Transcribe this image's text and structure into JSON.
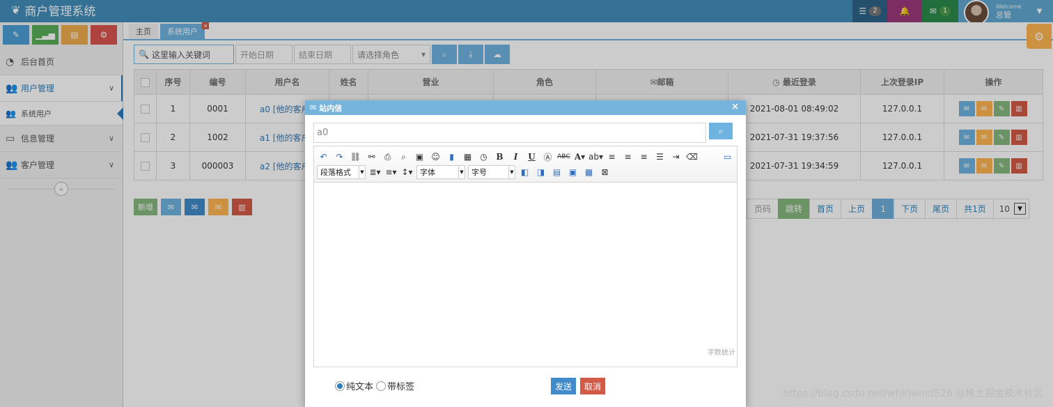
{
  "app": {
    "title": "商户管理系统"
  },
  "navbar": {
    "tasks_count": "2",
    "mail_count": "1",
    "welcome": "Welcome",
    "username": "总管"
  },
  "sidebar": {
    "items": [
      {
        "label": "后台首页",
        "icon": "dashboard-icon"
      },
      {
        "label": "用户管理",
        "icon": "users-icon"
      },
      {
        "label": "信息管理",
        "icon": "credit-card-icon"
      },
      {
        "label": "客户管理",
        "icon": "users-icon"
      }
    ],
    "sub_items": [
      {
        "label": "系统用户",
        "icon": "users-icon"
      }
    ],
    "collapse_label": "«"
  },
  "tabs": [
    {
      "label": "主页"
    },
    {
      "label": "系统用户"
    }
  ],
  "toolbar": {
    "search_placeholder": "这里输入关键词",
    "start_date_placeholder": "开始日期",
    "end_date_placeholder": "结束日期",
    "role_placeholder": "请选择角色"
  },
  "table": {
    "headers": [
      "序号",
      "编号",
      "用户名",
      "姓名",
      "营业",
      "角色",
      "邮箱",
      "最近登录",
      "上次登录IP",
      "操作"
    ],
    "rows": [
      {
        "index": "1",
        "code": "0001",
        "username": "a0 [他的客户",
        "last_login": "2021-08-01 08:49:02",
        "ip": "127.0.0.1"
      },
      {
        "index": "2",
        "code": "1002",
        "username": "a1 [他的客户",
        "last_login": "2021-07-31 19:37:56",
        "ip": "127.0.0.1"
      },
      {
        "index": "3",
        "code": "000003",
        "username": "a2 [他的客户",
        "last_login": "2021-07-31 19:34:59",
        "ip": "127.0.0.1"
      }
    ]
  },
  "bottom_buttons": {
    "add_label": "新增"
  },
  "pager": {
    "page_label": "页码",
    "go_label": "跳转",
    "first_label": "首页",
    "prev_label": "上页",
    "current": "1",
    "next_label": "下页",
    "last_label": "尾页",
    "total_label": "共1页",
    "page_size": "10"
  },
  "modal": {
    "title": "站内信",
    "to_value": "a0",
    "paragraph_label": "段落格式",
    "font_label": "字体",
    "size_label": "字号",
    "wordcount_label": "字数统计",
    "radio_plain": "纯文本",
    "radio_tagged": "带标签",
    "send_label": "发送",
    "cancel_label": "取消"
  },
  "watermark": "https://blog.csdn.net/whirlwind526  @稀土掘金技术社区",
  "colors": {
    "navbar": "#438eb9",
    "primary": "#6fb3e0",
    "success": "#87b87f",
    "warning": "#ffb752",
    "danger": "#d15b47"
  }
}
